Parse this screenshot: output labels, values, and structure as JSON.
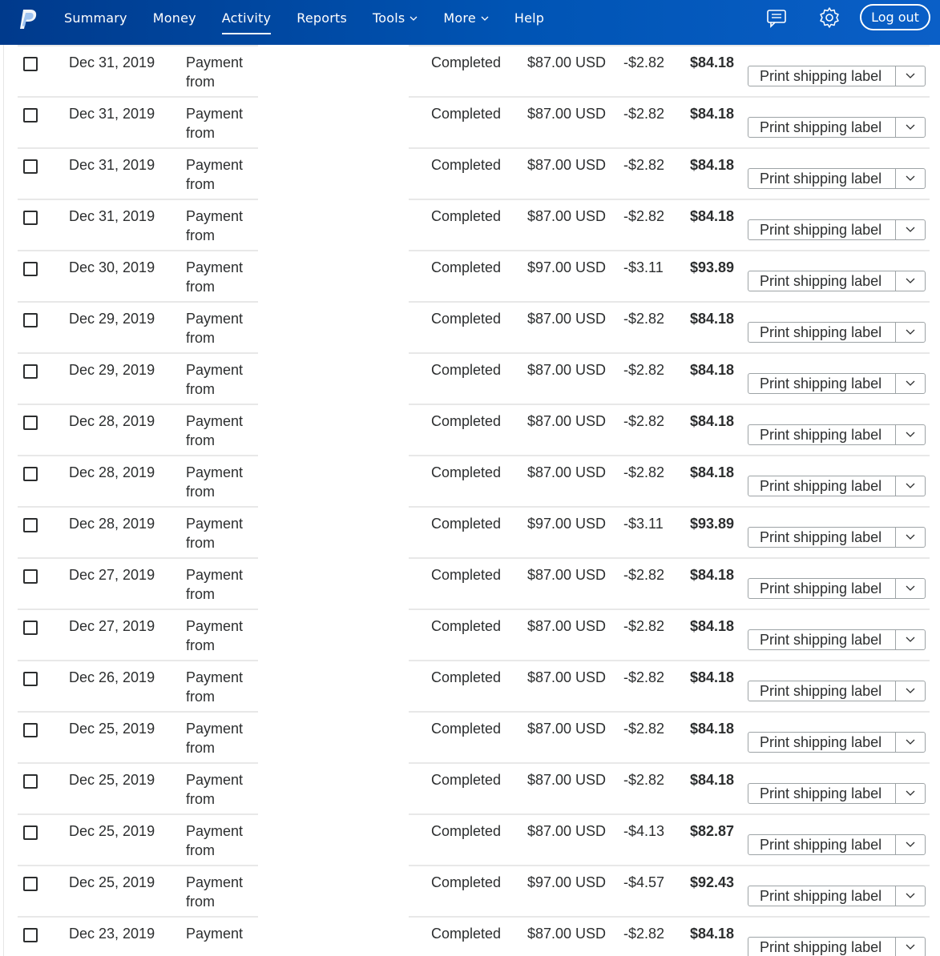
{
  "header": {
    "logo_icon": "paypal-logo",
    "nav": [
      {
        "label": "Summary",
        "active": false,
        "dropdown": false
      },
      {
        "label": "Money",
        "active": false,
        "dropdown": false
      },
      {
        "label": "Activity",
        "active": true,
        "dropdown": false
      },
      {
        "label": "Reports",
        "active": false,
        "dropdown": false
      },
      {
        "label": "Tools",
        "active": false,
        "dropdown": true
      },
      {
        "label": "More",
        "active": false,
        "dropdown": true
      },
      {
        "label": "Help",
        "active": false,
        "dropdown": false
      }
    ],
    "message_icon": "message-center-icon",
    "settings_icon": "gear-icon",
    "logout_label": "Log out"
  },
  "colors": {
    "header_gradient_start": "#003a8c",
    "header_gradient_end": "#0a5fc7",
    "text": "#2c2e2f",
    "divider": "#e8e8e8"
  },
  "transactions": [
    {
      "date": "Dec 31, 2019",
      "description": "Payment from",
      "status": "Completed",
      "gross": "$87.00 USD",
      "fee": "-$2.82",
      "net": "$84.18",
      "action": "Print shipping label"
    },
    {
      "date": "Dec 31, 2019",
      "description": "Payment from",
      "status": "Completed",
      "gross": "$87.00 USD",
      "fee": "-$2.82",
      "net": "$84.18",
      "action": "Print shipping label"
    },
    {
      "date": "Dec 31, 2019",
      "description": "Payment from",
      "status": "Completed",
      "gross": "$87.00 USD",
      "fee": "-$2.82",
      "net": "$84.18",
      "action": "Print shipping label"
    },
    {
      "date": "Dec 31, 2019",
      "description": "Payment from",
      "status": "Completed",
      "gross": "$87.00 USD",
      "fee": "-$2.82",
      "net": "$84.18",
      "action": "Print shipping label"
    },
    {
      "date": "Dec 30, 2019",
      "description": "Payment from",
      "status": "Completed",
      "gross": "$97.00 USD",
      "fee": "-$3.11",
      "net": "$93.89",
      "action": "Print shipping label"
    },
    {
      "date": "Dec 29, 2019",
      "description": "Payment from",
      "status": "Completed",
      "gross": "$87.00 USD",
      "fee": "-$2.82",
      "net": "$84.18",
      "action": "Print shipping label"
    },
    {
      "date": "Dec 29, 2019",
      "description": "Payment from",
      "status": "Completed",
      "gross": "$87.00 USD",
      "fee": "-$2.82",
      "net": "$84.18",
      "action": "Print shipping label"
    },
    {
      "date": "Dec 28, 2019",
      "description": "Payment from",
      "status": "Completed",
      "gross": "$87.00 USD",
      "fee": "-$2.82",
      "net": "$84.18",
      "action": "Print shipping label"
    },
    {
      "date": "Dec 28, 2019",
      "description": "Payment from",
      "status": "Completed",
      "gross": "$87.00 USD",
      "fee": "-$2.82",
      "net": "$84.18",
      "action": "Print shipping label"
    },
    {
      "date": "Dec 28, 2019",
      "description": "Payment from",
      "status": "Completed",
      "gross": "$97.00 USD",
      "fee": "-$3.11",
      "net": "$93.89",
      "action": "Print shipping label"
    },
    {
      "date": "Dec 27, 2019",
      "description": "Payment from",
      "status": "Completed",
      "gross": "$87.00 USD",
      "fee": "-$2.82",
      "net": "$84.18",
      "action": "Print shipping label"
    },
    {
      "date": "Dec 27, 2019",
      "description": "Payment from",
      "status": "Completed",
      "gross": "$87.00 USD",
      "fee": "-$2.82",
      "net": "$84.18",
      "action": "Print shipping label"
    },
    {
      "date": "Dec 26, 2019",
      "description": "Payment from",
      "status": "Completed",
      "gross": "$87.00 USD",
      "fee": "-$2.82",
      "net": "$84.18",
      "action": "Print shipping label"
    },
    {
      "date": "Dec 25, 2019",
      "description": "Payment from",
      "status": "Completed",
      "gross": "$87.00 USD",
      "fee": "-$2.82",
      "net": "$84.18",
      "action": "Print shipping label"
    },
    {
      "date": "Dec 25, 2019",
      "description": "Payment from",
      "status": "Completed",
      "gross": "$87.00 USD",
      "fee": "-$2.82",
      "net": "$84.18",
      "action": "Print shipping label"
    },
    {
      "date": "Dec 25, 2019",
      "description": "Payment from",
      "status": "Completed",
      "gross": "$87.00 USD",
      "fee": "-$4.13",
      "net": "$82.87",
      "action": "Print shipping label"
    },
    {
      "date": "Dec 25, 2019",
      "description": "Payment from",
      "status": "Completed",
      "gross": "$97.00 USD",
      "fee": "-$4.57",
      "net": "$92.43",
      "action": "Print shipping label"
    },
    {
      "date": "Dec 23, 2019",
      "description": "Payment",
      "status": "Completed",
      "gross": "$87.00 USD",
      "fee": "-$2.82",
      "net": "$84.18",
      "action": "Print shipping label"
    }
  ]
}
